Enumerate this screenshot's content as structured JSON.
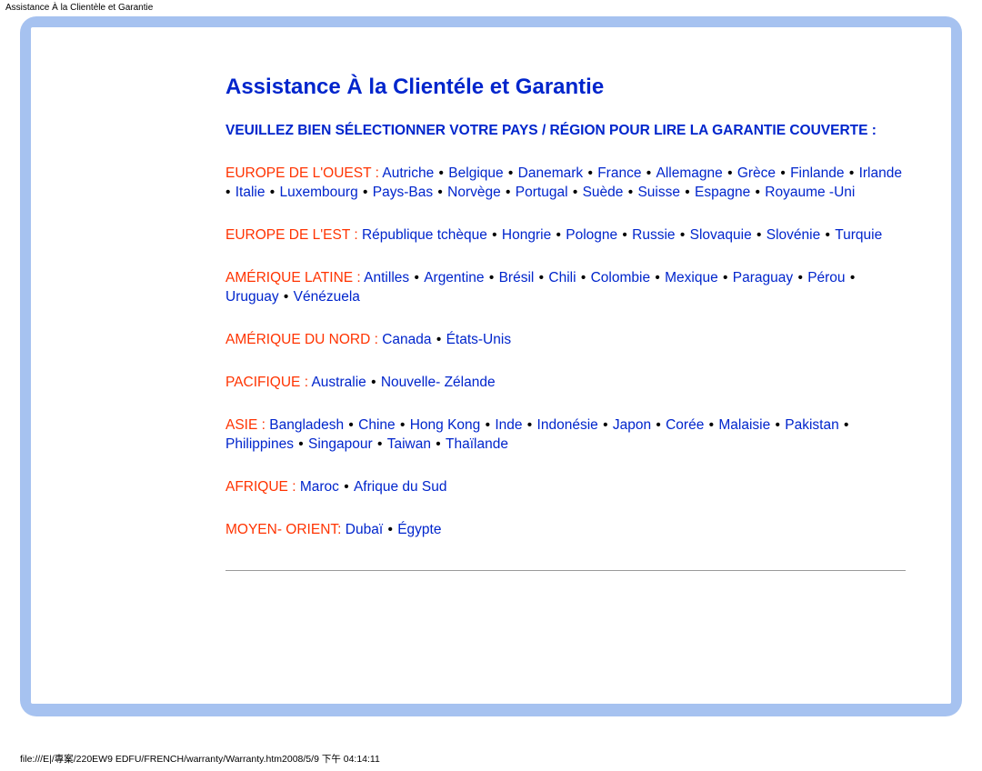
{
  "meta": {
    "top_label": "Assistance À la Clientèle et Garantie",
    "footer_path": "file:///E|/專案/220EW9 EDFU/FRENCH/warranty/Warranty.htm2008/5/9 下午 04:14:11"
  },
  "heading": "Assistance À la Clientéle et Garantie",
  "instruction": "VEUILLEZ BIEN SÉLECTIONNER VOTRE PAYS / RÉGION POUR LIRE LA GARANTIE COUVERTE :",
  "regions": [
    {
      "label": "EUROPE DE L'OUEST : ",
      "countries": [
        "Autriche",
        "Belgique",
        "Danemark",
        "France",
        "Allemagne",
        "Grèce",
        "Finlande",
        "Irlande",
        "Italie",
        "Luxembourg",
        "Pays-Bas",
        "Norvège",
        "Portugal",
        "Suède",
        "Suisse",
        "Espagne",
        "Royaume -Uni"
      ],
      "trailing_bullet": false
    },
    {
      "label": "EUROPE DE L'EST : ",
      "countries": [
        "République tchèque",
        "Hongrie",
        "Pologne",
        "Russie",
        "Slovaquie",
        "Slovénie",
        "Turquie"
      ],
      "trailing_bullet": false
    },
    {
      "label": "AMÉRIQUE LATINE : ",
      "countries": [
        "Antilles",
        "Argentine",
        "Brésil",
        "Chili",
        "Colombie",
        "Mexique",
        "Paraguay",
        "Pérou",
        "Uruguay",
        "Vénézuela"
      ],
      "trailing_bullet": false
    },
    {
      "label": "AMÉRIQUE DU NORD : ",
      "countries": [
        "Canada",
        "États-Unis"
      ],
      "trailing_bullet": false
    },
    {
      "label": "PACIFIQUE : ",
      "countries": [
        "Australie",
        "Nouvelle- Zélande"
      ],
      "trailing_bullet": false
    },
    {
      "label": "ASIE : ",
      "countries": [
        "Bangladesh",
        "Chine",
        "Hong Kong",
        "Inde",
        "Indonésie",
        "Japon",
        "Corée",
        "Malaisie",
        "Pakistan",
        "Philippines",
        "Singapour",
        "Taiwan",
        "Thaïlande"
      ],
      "trailing_bullet": false
    },
    {
      "label": "AFRIQUE : ",
      "countries": [
        "Maroc",
        "Afrique du Sud"
      ],
      "trailing_bullet": false
    },
    {
      "label": "MOYEN- ORIENT: ",
      "countries": [
        "Dubaï",
        "Égypte"
      ],
      "trailing_bullet": false
    }
  ]
}
